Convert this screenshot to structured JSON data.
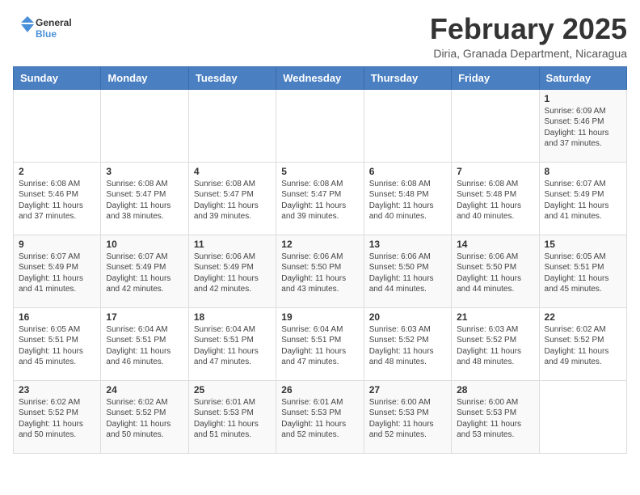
{
  "header": {
    "logo_general": "General",
    "logo_blue": "Blue",
    "month_year": "February 2025",
    "location": "Diria, Granada Department, Nicaragua"
  },
  "weekdays": [
    "Sunday",
    "Monday",
    "Tuesday",
    "Wednesday",
    "Thursday",
    "Friday",
    "Saturday"
  ],
  "weeks": [
    [
      {
        "day": "",
        "info": ""
      },
      {
        "day": "",
        "info": ""
      },
      {
        "day": "",
        "info": ""
      },
      {
        "day": "",
        "info": ""
      },
      {
        "day": "",
        "info": ""
      },
      {
        "day": "",
        "info": ""
      },
      {
        "day": "1",
        "info": "Sunrise: 6:09 AM\nSunset: 5:46 PM\nDaylight: 11 hours\nand 37 minutes."
      }
    ],
    [
      {
        "day": "2",
        "info": "Sunrise: 6:08 AM\nSunset: 5:46 PM\nDaylight: 11 hours\nand 37 minutes."
      },
      {
        "day": "3",
        "info": "Sunrise: 6:08 AM\nSunset: 5:47 PM\nDaylight: 11 hours\nand 38 minutes."
      },
      {
        "day": "4",
        "info": "Sunrise: 6:08 AM\nSunset: 5:47 PM\nDaylight: 11 hours\nand 39 minutes."
      },
      {
        "day": "5",
        "info": "Sunrise: 6:08 AM\nSunset: 5:47 PM\nDaylight: 11 hours\nand 39 minutes."
      },
      {
        "day": "6",
        "info": "Sunrise: 6:08 AM\nSunset: 5:48 PM\nDaylight: 11 hours\nand 40 minutes."
      },
      {
        "day": "7",
        "info": "Sunrise: 6:08 AM\nSunset: 5:48 PM\nDaylight: 11 hours\nand 40 minutes."
      },
      {
        "day": "8",
        "info": "Sunrise: 6:07 AM\nSunset: 5:49 PM\nDaylight: 11 hours\nand 41 minutes."
      }
    ],
    [
      {
        "day": "9",
        "info": "Sunrise: 6:07 AM\nSunset: 5:49 PM\nDaylight: 11 hours\nand 41 minutes."
      },
      {
        "day": "10",
        "info": "Sunrise: 6:07 AM\nSunset: 5:49 PM\nDaylight: 11 hours\nand 42 minutes."
      },
      {
        "day": "11",
        "info": "Sunrise: 6:06 AM\nSunset: 5:49 PM\nDaylight: 11 hours\nand 42 minutes."
      },
      {
        "day": "12",
        "info": "Sunrise: 6:06 AM\nSunset: 5:50 PM\nDaylight: 11 hours\nand 43 minutes."
      },
      {
        "day": "13",
        "info": "Sunrise: 6:06 AM\nSunset: 5:50 PM\nDaylight: 11 hours\nand 44 minutes."
      },
      {
        "day": "14",
        "info": "Sunrise: 6:06 AM\nSunset: 5:50 PM\nDaylight: 11 hours\nand 44 minutes."
      },
      {
        "day": "15",
        "info": "Sunrise: 6:05 AM\nSunset: 5:51 PM\nDaylight: 11 hours\nand 45 minutes."
      }
    ],
    [
      {
        "day": "16",
        "info": "Sunrise: 6:05 AM\nSunset: 5:51 PM\nDaylight: 11 hours\nand 45 minutes."
      },
      {
        "day": "17",
        "info": "Sunrise: 6:04 AM\nSunset: 5:51 PM\nDaylight: 11 hours\nand 46 minutes."
      },
      {
        "day": "18",
        "info": "Sunrise: 6:04 AM\nSunset: 5:51 PM\nDaylight: 11 hours\nand 47 minutes."
      },
      {
        "day": "19",
        "info": "Sunrise: 6:04 AM\nSunset: 5:51 PM\nDaylight: 11 hours\nand 47 minutes."
      },
      {
        "day": "20",
        "info": "Sunrise: 6:03 AM\nSunset: 5:52 PM\nDaylight: 11 hours\nand 48 minutes."
      },
      {
        "day": "21",
        "info": "Sunrise: 6:03 AM\nSunset: 5:52 PM\nDaylight: 11 hours\nand 48 minutes."
      },
      {
        "day": "22",
        "info": "Sunrise: 6:02 AM\nSunset: 5:52 PM\nDaylight: 11 hours\nand 49 minutes."
      }
    ],
    [
      {
        "day": "23",
        "info": "Sunrise: 6:02 AM\nSunset: 5:52 PM\nDaylight: 11 hours\nand 50 minutes."
      },
      {
        "day": "24",
        "info": "Sunrise: 6:02 AM\nSunset: 5:52 PM\nDaylight: 11 hours\nand 50 minutes."
      },
      {
        "day": "25",
        "info": "Sunrise: 6:01 AM\nSunset: 5:53 PM\nDaylight: 11 hours\nand 51 minutes."
      },
      {
        "day": "26",
        "info": "Sunrise: 6:01 AM\nSunset: 5:53 PM\nDaylight: 11 hours\nand 52 minutes."
      },
      {
        "day": "27",
        "info": "Sunrise: 6:00 AM\nSunset: 5:53 PM\nDaylight: 11 hours\nand 52 minutes."
      },
      {
        "day": "28",
        "info": "Sunrise: 6:00 AM\nSunset: 5:53 PM\nDaylight: 11 hours\nand 53 minutes."
      },
      {
        "day": "",
        "info": ""
      }
    ]
  ]
}
